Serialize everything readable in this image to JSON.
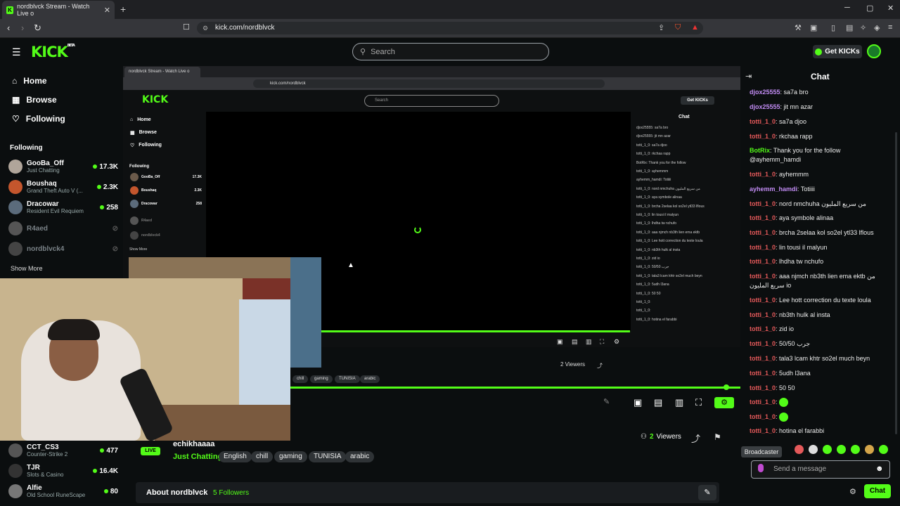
{
  "browser": {
    "tab_title": "nordblvck Stream - Watch Live o",
    "url": "kick.com/nordblvck"
  },
  "header": {
    "logo": "KICK",
    "logo_sup": "BETA",
    "search_placeholder": "Search",
    "get_kicks": "Get KICKs"
  },
  "sidebar": {
    "nav": [
      {
        "label": "Home",
        "icon": "home-icon"
      },
      {
        "label": "Browse",
        "icon": "browse-icon"
      },
      {
        "label": "Following",
        "icon": "heart-icon"
      }
    ],
    "following_title": "Following",
    "following": [
      {
        "name": "GooBa_Off",
        "game": "Just Chatting",
        "viewers": "17.3K"
      },
      {
        "name": "Boushaq",
        "game": "Grand Theft Auto V (...",
        "viewers": "2.3K"
      },
      {
        "name": "Dracowar",
        "game": "Resident Evil Requiem",
        "viewers": "258"
      },
      {
        "name": "R4aed",
        "game": "",
        "viewers": ""
      },
      {
        "name": "nordblvck4",
        "game": "",
        "viewers": ""
      }
    ],
    "show_more": "Show More",
    "lower": [
      {
        "name": "CCT_CS3",
        "game": "Counter-Strike 2",
        "viewers": "477"
      },
      {
        "name": "TJR",
        "game": "Slots & Casino",
        "viewers": "16.4K"
      },
      {
        "name": "Alfie",
        "game": "Old School RuneScape",
        "viewers": "80"
      }
    ]
  },
  "nested": {
    "tab_title": "nordblvck Stream - Watch Live o",
    "url": "kick.com/nordblvck",
    "search": "Search",
    "get_kicks": "Get KICKs",
    "chat": "Chat",
    "nav": [
      "Home",
      "Browse",
      "Following"
    ],
    "following_title": "Following",
    "following": [
      {
        "name": "GooBa_Off",
        "viewers": "17.3K"
      },
      {
        "name": "Boushaq",
        "viewers": "2.3K"
      },
      {
        "name": "Dracowar",
        "viewers": "258"
      },
      {
        "name": "R4aed",
        "viewers": ""
      },
      {
        "name": "nordblvck4",
        "viewers": ""
      }
    ],
    "show_more": "Show More",
    "viewers": "2 Viewers",
    "tags": [
      "chill",
      "gaming",
      "TUNISIA",
      "arabic"
    ],
    "messages": [
      "djox25555: sa7a bro",
      "djox25555: jit mn azar",
      "totti_1_0: sa7a djoo",
      "totti_1_0: rkchaa rapp",
      "BotRix: Thank you for the follow",
      "totti_1_0: ayhemmm",
      "ayhemm_hamdi: Totiiii",
      "totti_1_0: nord nmchuha من سريع المليون",
      "totti_1_0: aya symbole alinaa",
      "totti_1_0: brcha 2selaa kol so2el ytl33 lflous",
      "totti_1_0: lin tousi il malyun",
      "totti_1_0: lhdha tw nchufo",
      "totti_1_0: aaa njmch nb3th lien ema ektb",
      "totti_1_0: Lee hott correction du texte loula",
      "totti_1_0: nb3th hulk al insta",
      "totti_1_0: zid io",
      "totti_1_0: 50/50 جرب",
      "totti_1_0: tala3 lcam khtr so2el much beyn",
      "totti_1_0: 5udh l3ana",
      "totti_1_0: 50 50",
      "totti_1_0:",
      "totti_1_0:",
      "totti_1_0: hotina el farabbi"
    ]
  },
  "channel": {
    "live_badge": "LIVE",
    "streamer": "echikhaaaa",
    "category": "Just Chatting",
    "tags": [
      "English",
      "chill",
      "gaming",
      "TUNISIA",
      "arabic"
    ],
    "viewers_count": "2",
    "viewers_label": "Viewers",
    "about_title": "About nordblvck",
    "followers": "5 Followers"
  },
  "chat": {
    "title": "Chat",
    "messages": [
      {
        "user": "djox25555",
        "color": "purp",
        "text": "sa7a bro"
      },
      {
        "user": "djox25555",
        "color": "purp",
        "text": "jit mn azar"
      },
      {
        "user": "totti_1_0",
        "color": "red",
        "text": "sa7a djoo"
      },
      {
        "user": "totti_1_0",
        "color": "red",
        "text": "rkchaa rapp"
      },
      {
        "user": "BotRix",
        "color": "grn",
        "text": "Thank you for the follow @ayhemm_hamdi"
      },
      {
        "user": "totti_1_0",
        "color": "red",
        "text": "ayhemmm"
      },
      {
        "user": "ayhemm_hamdi",
        "color": "purp",
        "text": "Totiiii"
      },
      {
        "user": "totti_1_0",
        "color": "red",
        "text": "nord nmchuha من سريع المليون"
      },
      {
        "user": "totti_1_0",
        "color": "red",
        "text": "aya symbole alinaa"
      },
      {
        "user": "totti_1_0",
        "color": "red",
        "text": "brcha 2selaa kol so2el ytl33 lflous"
      },
      {
        "user": "totti_1_0",
        "color": "red",
        "text": "lin tousi il malyun"
      },
      {
        "user": "totti_1_0",
        "color": "red",
        "text": "lhdha tw nchufo"
      },
      {
        "user": "totti_1_0",
        "color": "red",
        "text": "aaa njmch nb3th lien ema ektb من سريع المليون io"
      },
      {
        "user": "totti_1_0",
        "color": "red",
        "text": "Lee hott correction du texte loula"
      },
      {
        "user": "totti_1_0",
        "color": "red",
        "text": "nb3th hulk al insta"
      },
      {
        "user": "totti_1_0",
        "color": "red",
        "text": "zid io"
      },
      {
        "user": "totti_1_0",
        "color": "red",
        "text": "50/50 جرب"
      },
      {
        "user": "totti_1_0",
        "color": "red",
        "text": "tala3 lcam khtr so2el much beyn"
      },
      {
        "user": "totti_1_0",
        "color": "red",
        "text": "5udh l3ana"
      },
      {
        "user": "totti_1_0",
        "color": "red",
        "text": "50 50"
      },
      {
        "user": "totti_1_0",
        "color": "red",
        "text": ""
      },
      {
        "user": "totti_1_0",
        "color": "red",
        "text": ""
      },
      {
        "user": "totti_1_0",
        "color": "red",
        "text": "hotina el farabbi"
      }
    ],
    "broadcaster_tooltip": "Broadcaster",
    "input_placeholder": "Send a message",
    "send_label": "Chat"
  },
  "colors": {
    "accent": "#53fc18",
    "background": "#0b0e0f"
  }
}
